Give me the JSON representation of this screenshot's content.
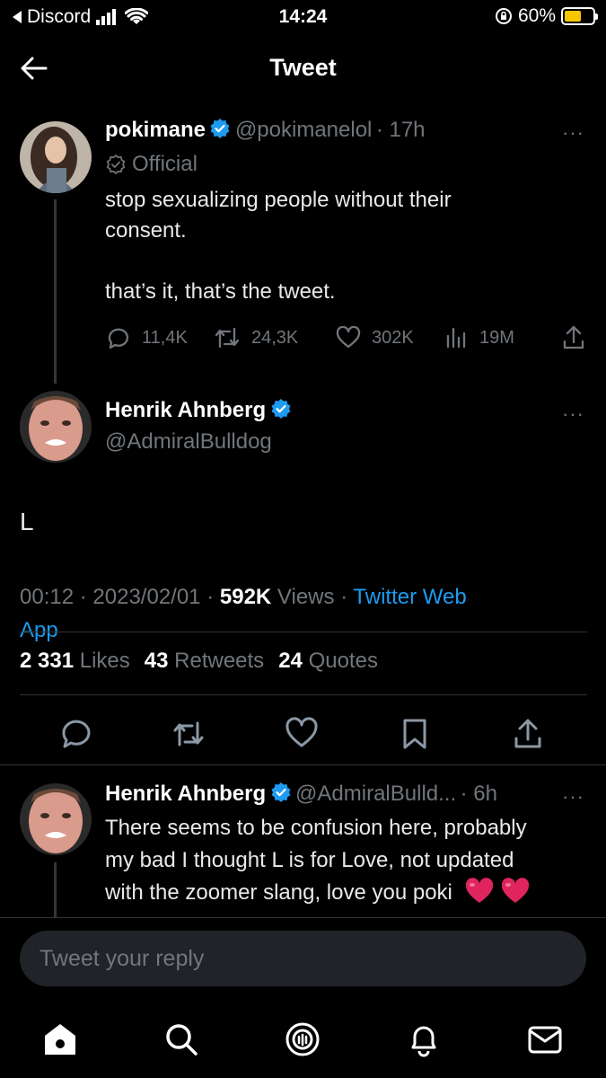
{
  "status_bar": {
    "back_app": "Discord",
    "time": "14:24",
    "battery": "60%",
    "battery_level": 0.6
  },
  "header": {
    "title": "Tweet"
  },
  "parent_tweet": {
    "name": "pokimane",
    "handle": "@pokimanelol",
    "time": "· 17h",
    "label": "Official",
    "text_line1": "stop sexualizing people without their",
    "text_line2": "consent.",
    "text_line3": "that’s it, that’s the tweet.",
    "replies": "11,4K",
    "retweets": "24,3K",
    "likes": "302K",
    "views": "19M"
  },
  "main_tweet": {
    "name": "Henrik Ahnberg",
    "handle": "@AdmiralBulldog",
    "text": "L",
    "time": "00:12",
    "date": "2023/02/01",
    "views_count": "592K",
    "views_label": "Views",
    "source_line1": "Twitter Web",
    "source_line2": "App",
    "likes_count": "2 331",
    "likes_label": "Likes",
    "retweets_count": "43",
    "retweets_label": "Retweets",
    "quotes_count": "24",
    "quotes_label": "Quotes"
  },
  "reply_tweet": {
    "name": "Henrik Ahnberg",
    "handle": "@AdmiralBulld...",
    "time": "· 6h",
    "line1": "There seems to be confusion here, probably",
    "line2": "my bad I thought L is for Love, not updated",
    "line3": "with the zoomer slang, love you poki"
  },
  "reply_bar": {
    "placeholder": "Tweet your reply"
  },
  "more_label": "···",
  "colors": {
    "accent": "#1d9bf0",
    "heart": "#e0245e",
    "battery": "#f7c600"
  }
}
